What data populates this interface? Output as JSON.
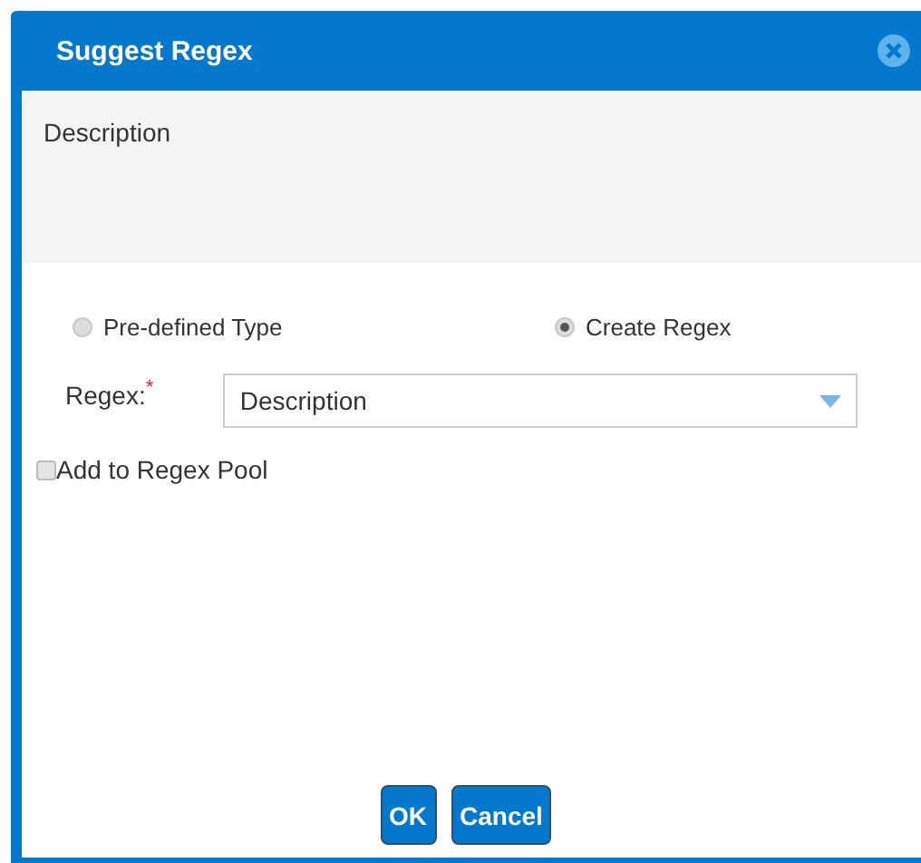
{
  "window": {
    "title": "Suggest Regex"
  },
  "description": {
    "value": "Description"
  },
  "options": [
    {
      "label": "Pre-defined Type",
      "selected": false
    },
    {
      "label": "Create Regex",
      "selected": true
    }
  ],
  "regex": {
    "label": "Regex:",
    "required_mark": "*",
    "value": "Description"
  },
  "pool_checkbox": {
    "label": "Add to Regex Pool",
    "checked": false
  },
  "buttons": [
    "OK",
    "Cancel"
  ]
}
